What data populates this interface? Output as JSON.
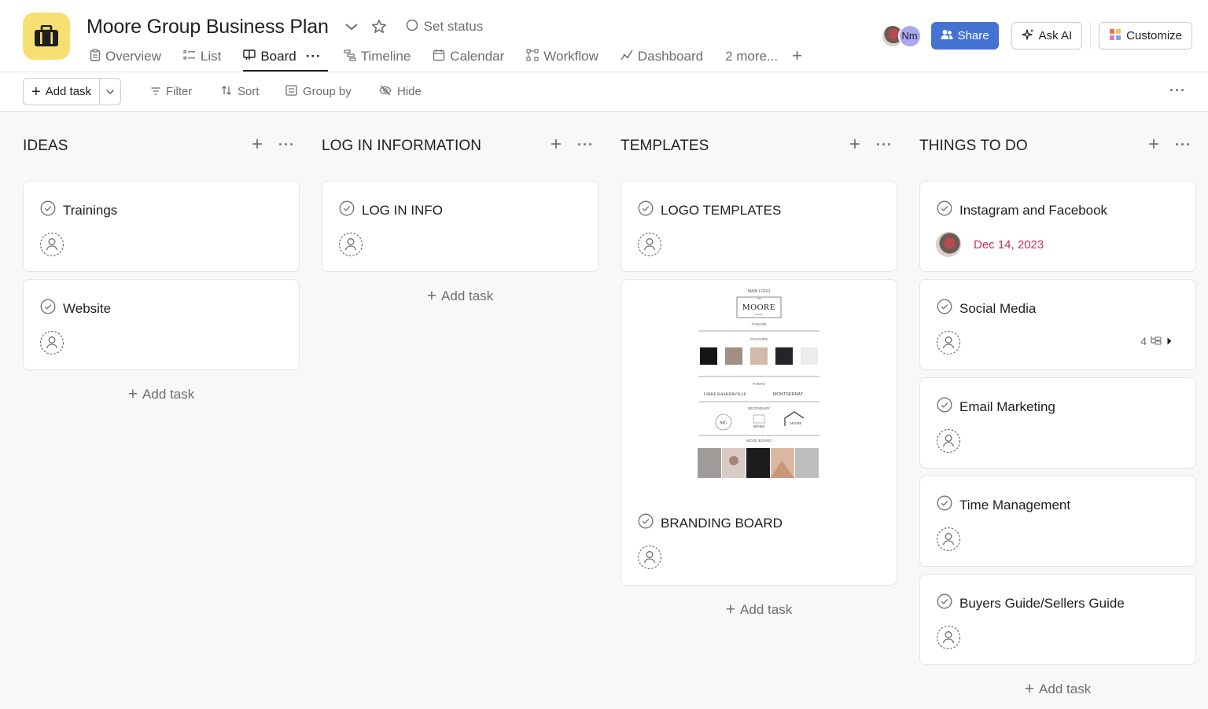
{
  "project": {
    "title": "Moore Group Business Plan",
    "set_status_label": "Set status"
  },
  "tabs": [
    {
      "label": "Overview",
      "icon": "clipboard-icon"
    },
    {
      "label": "List",
      "icon": "list-icon"
    },
    {
      "label": "Board",
      "icon": "board-icon",
      "active": true
    },
    {
      "label": "Timeline",
      "icon": "timeline-icon"
    },
    {
      "label": "Calendar",
      "icon": "calendar-icon"
    },
    {
      "label": "Workflow",
      "icon": "workflow-icon"
    },
    {
      "label": "Dashboard",
      "icon": "dashboard-icon"
    },
    {
      "label": "2 more..."
    }
  ],
  "header_actions": {
    "avatar_initials": "Nm",
    "share_label": "Share",
    "ask_ai_label": "Ask AI",
    "customize_label": "Customize"
  },
  "toolbar": {
    "add_task_label": "Add task",
    "filter_label": "Filter",
    "sort_label": "Sort",
    "group_by_label": "Group by",
    "hide_label": "Hide"
  },
  "columns": [
    {
      "title": "IDEAS",
      "cards": [
        {
          "title": "Trainings"
        },
        {
          "title": "Website"
        }
      ],
      "add_task_label": "Add task"
    },
    {
      "title": "LOG IN INFORMATION",
      "cards": [
        {
          "title": "LOG IN INFO"
        }
      ],
      "add_task_label": "Add task"
    },
    {
      "title": "TEMPLATES",
      "cards": [
        {
          "title": "LOGO TEMPLATES"
        },
        {
          "title": "BRANDING BOARD",
          "image": {
            "main_logo": "MAIN LOGO",
            "the": "THE",
            "logo_text": "MOORE",
            "group": "GROUP",
            "tagline": "TAGLINE",
            "colours": "COLOURS",
            "fonts": "FONTS",
            "font_1": "LIBRE BASKERVILLE",
            "font_2": "MONTSERRAT",
            "secondary": "SECONDARY",
            "mg": "MG",
            "mood_board": "MOOD BOARD"
          }
        }
      ],
      "add_task_label": "Add task"
    },
    {
      "title": "THINGS TO DO",
      "cards": [
        {
          "title": "Instagram and Facebook",
          "due": "Dec 14, 2023"
        },
        {
          "title": "Social Media",
          "subtasks": "4"
        },
        {
          "title": "Email Marketing"
        },
        {
          "title": "Time Management"
        },
        {
          "title": "Buyers Guide/Sellers Guide"
        }
      ],
      "add_task_label": "Add task"
    }
  ],
  "colors": {
    "accent": "#4573d2",
    "project_icon_bg": "#f8df72",
    "due_date": "#c92f54"
  }
}
